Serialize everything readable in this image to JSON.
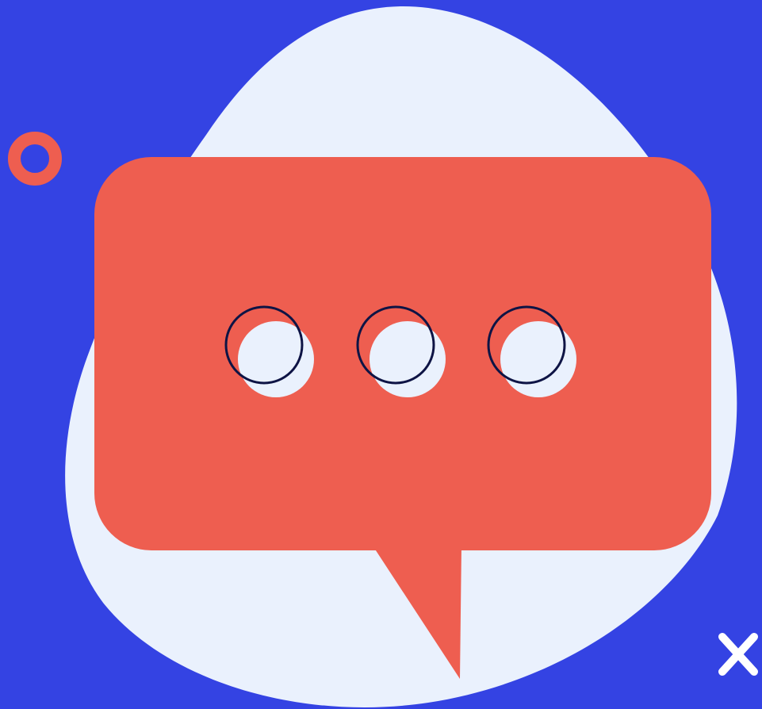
{
  "illustration": {
    "subject": "chat-bubble-with-typing-dots",
    "icon_names": [
      "ring-icon",
      "chat-bubble-icon",
      "typing-dot-icon",
      "close-icon"
    ],
    "colors": {
      "background": "#3443E3",
      "blob": "#EAF1FD",
      "bubble": "#EE5E50",
      "dot_fill": "#EAF1FD",
      "dot_outline": "#0E1445",
      "ring": "#EE5E50",
      "cross": "#FFFFFF"
    },
    "typing_dot_count": 3
  }
}
